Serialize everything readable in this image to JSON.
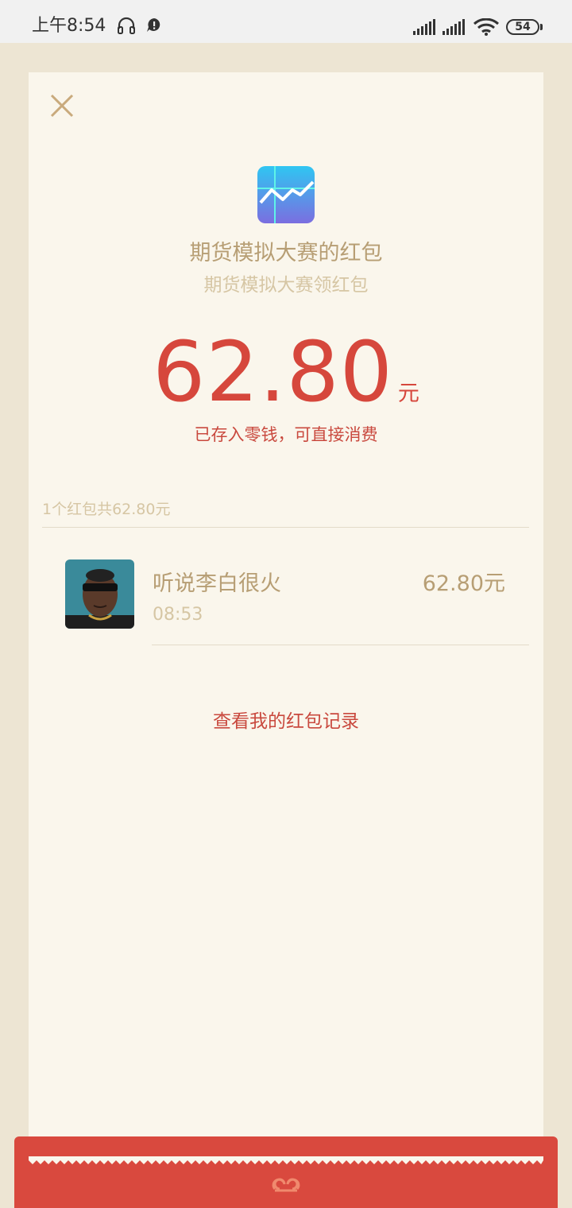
{
  "status_bar": {
    "time": "上午8:54",
    "battery": "54",
    "icons": [
      "headset-icon",
      "alert-icon",
      "signal-icon",
      "signal-icon",
      "wifi-icon",
      "battery-icon"
    ]
  },
  "header": {
    "close_icon": "close-icon",
    "app_icon": "stock-chart-app-icon",
    "title": "期货模拟大赛的红包",
    "subtitle": "期货模拟大赛领红包"
  },
  "amount": {
    "value": "62.80",
    "unit": "元",
    "note": "已存入零钱，可直接消费"
  },
  "summary": "1个红包共62.80元",
  "receivers": [
    {
      "name": "听说李白很火",
      "time": "08:53",
      "amount": "62.80元",
      "avatar": "user-avatar"
    }
  ],
  "history_link": "查看我的红包记录",
  "colors": {
    "background": "#ede5d3",
    "card": "#faf6ec",
    "gold_text": "#b79e74",
    "light_gold_text": "#d6c6a4",
    "red": "#d6473c",
    "bottom_band": "#d9493e"
  }
}
